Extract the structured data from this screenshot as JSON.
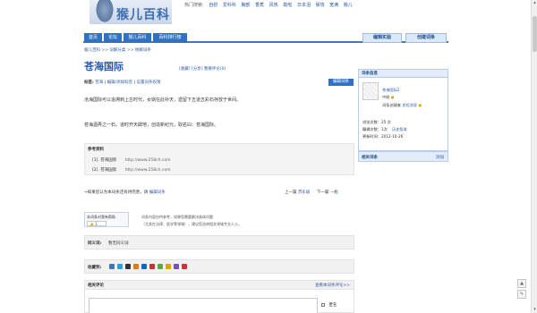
{
  "header": {
    "logo_text": "猴儿百科",
    "hot_label": "热门搜索:",
    "hot_keywords": [
      "自慰",
      "爱科科",
      "胸部",
      "香蕉",
      "风热",
      "勒啦",
      "日本泪",
      "悬境",
      "宽满",
      "猴儿"
    ]
  },
  "nav": {
    "tabs": [
      "首页",
      "论坛",
      "猴儿百科",
      "百科排行榜"
    ],
    "right_tabs": [
      "编辑实验",
      "创建词条"
    ]
  },
  "breadcrumb": [
    "猴儿百科",
    "词解分类",
    "地解词条"
  ],
  "entry": {
    "title": "苍海国际",
    "tools": "[收藏]   [分享]   我要评论(0)",
    "tags_label": "标签:",
    "tags": [
      "苍海",
      "编辑/添加标签",
      "设置词条权限"
    ],
    "edit_button": "编辑词条",
    "paragraph1": "沧海国际可以追溯到上古时代，女娲在此补天，遗留下五道五彩石存放于世间。",
    "paragraph2": "苍海酒弄之一石，道时开天辟地，创造新纪元，取名曰：苍海国际。"
  },
  "references": {
    "heading": "参考资料",
    "items": [
      {
        "index": "[1].",
        "name": "苍海国际",
        "url": "http://www.258ch.com"
      },
      {
        "index": "[2].",
        "name": "苍海国际",
        "url": "http://www.258ch.com"
      }
    ]
  },
  "fix": {
    "text": "→如果您认为本词条还有待完善，请",
    "link": "编辑词条"
  },
  "prevnext": {
    "prev_label": "上一篇",
    "prev_link": "苏东坡",
    "next_label": "下一篇",
    "next_link": "一瓶"
  },
  "helpful": {
    "text": "本词条对我有帮助",
    "count": "1"
  },
  "notice": {
    "line1": "词条内容仅供参考，如果您需要解决具体问题",
    "line2": "（尤其在法律、医学等领域），建议您咨询相关领域专业人士。"
  },
  "related_entries": {
    "label": "同义词:",
    "value": "暂无同义词"
  },
  "share": {
    "label": "收藏到:",
    "colors": [
      "#3a78c3",
      "#2aa1d8",
      "#333333",
      "#e07b18",
      "#1c64c2",
      "#d12f2f",
      "#5aa843",
      "#e6a200",
      "#7a4fc1",
      "#cc3333"
    ]
  },
  "comments": {
    "label": "相关评论",
    "link": "查看本词条评论>>",
    "anon": "匿名"
  },
  "sidebar": {
    "header": "词条信息",
    "user": "苍海国际2",
    "level": "中尉",
    "send_msg": "发短消息",
    "author_line": "词条创建者",
    "views": "浏览次数：25 次",
    "edits": "编辑次数：1次",
    "history": "历史版本",
    "updated": "更新时间：2012-10-26",
    "related_label": "相关词条",
    "related_add": "添加"
  }
}
